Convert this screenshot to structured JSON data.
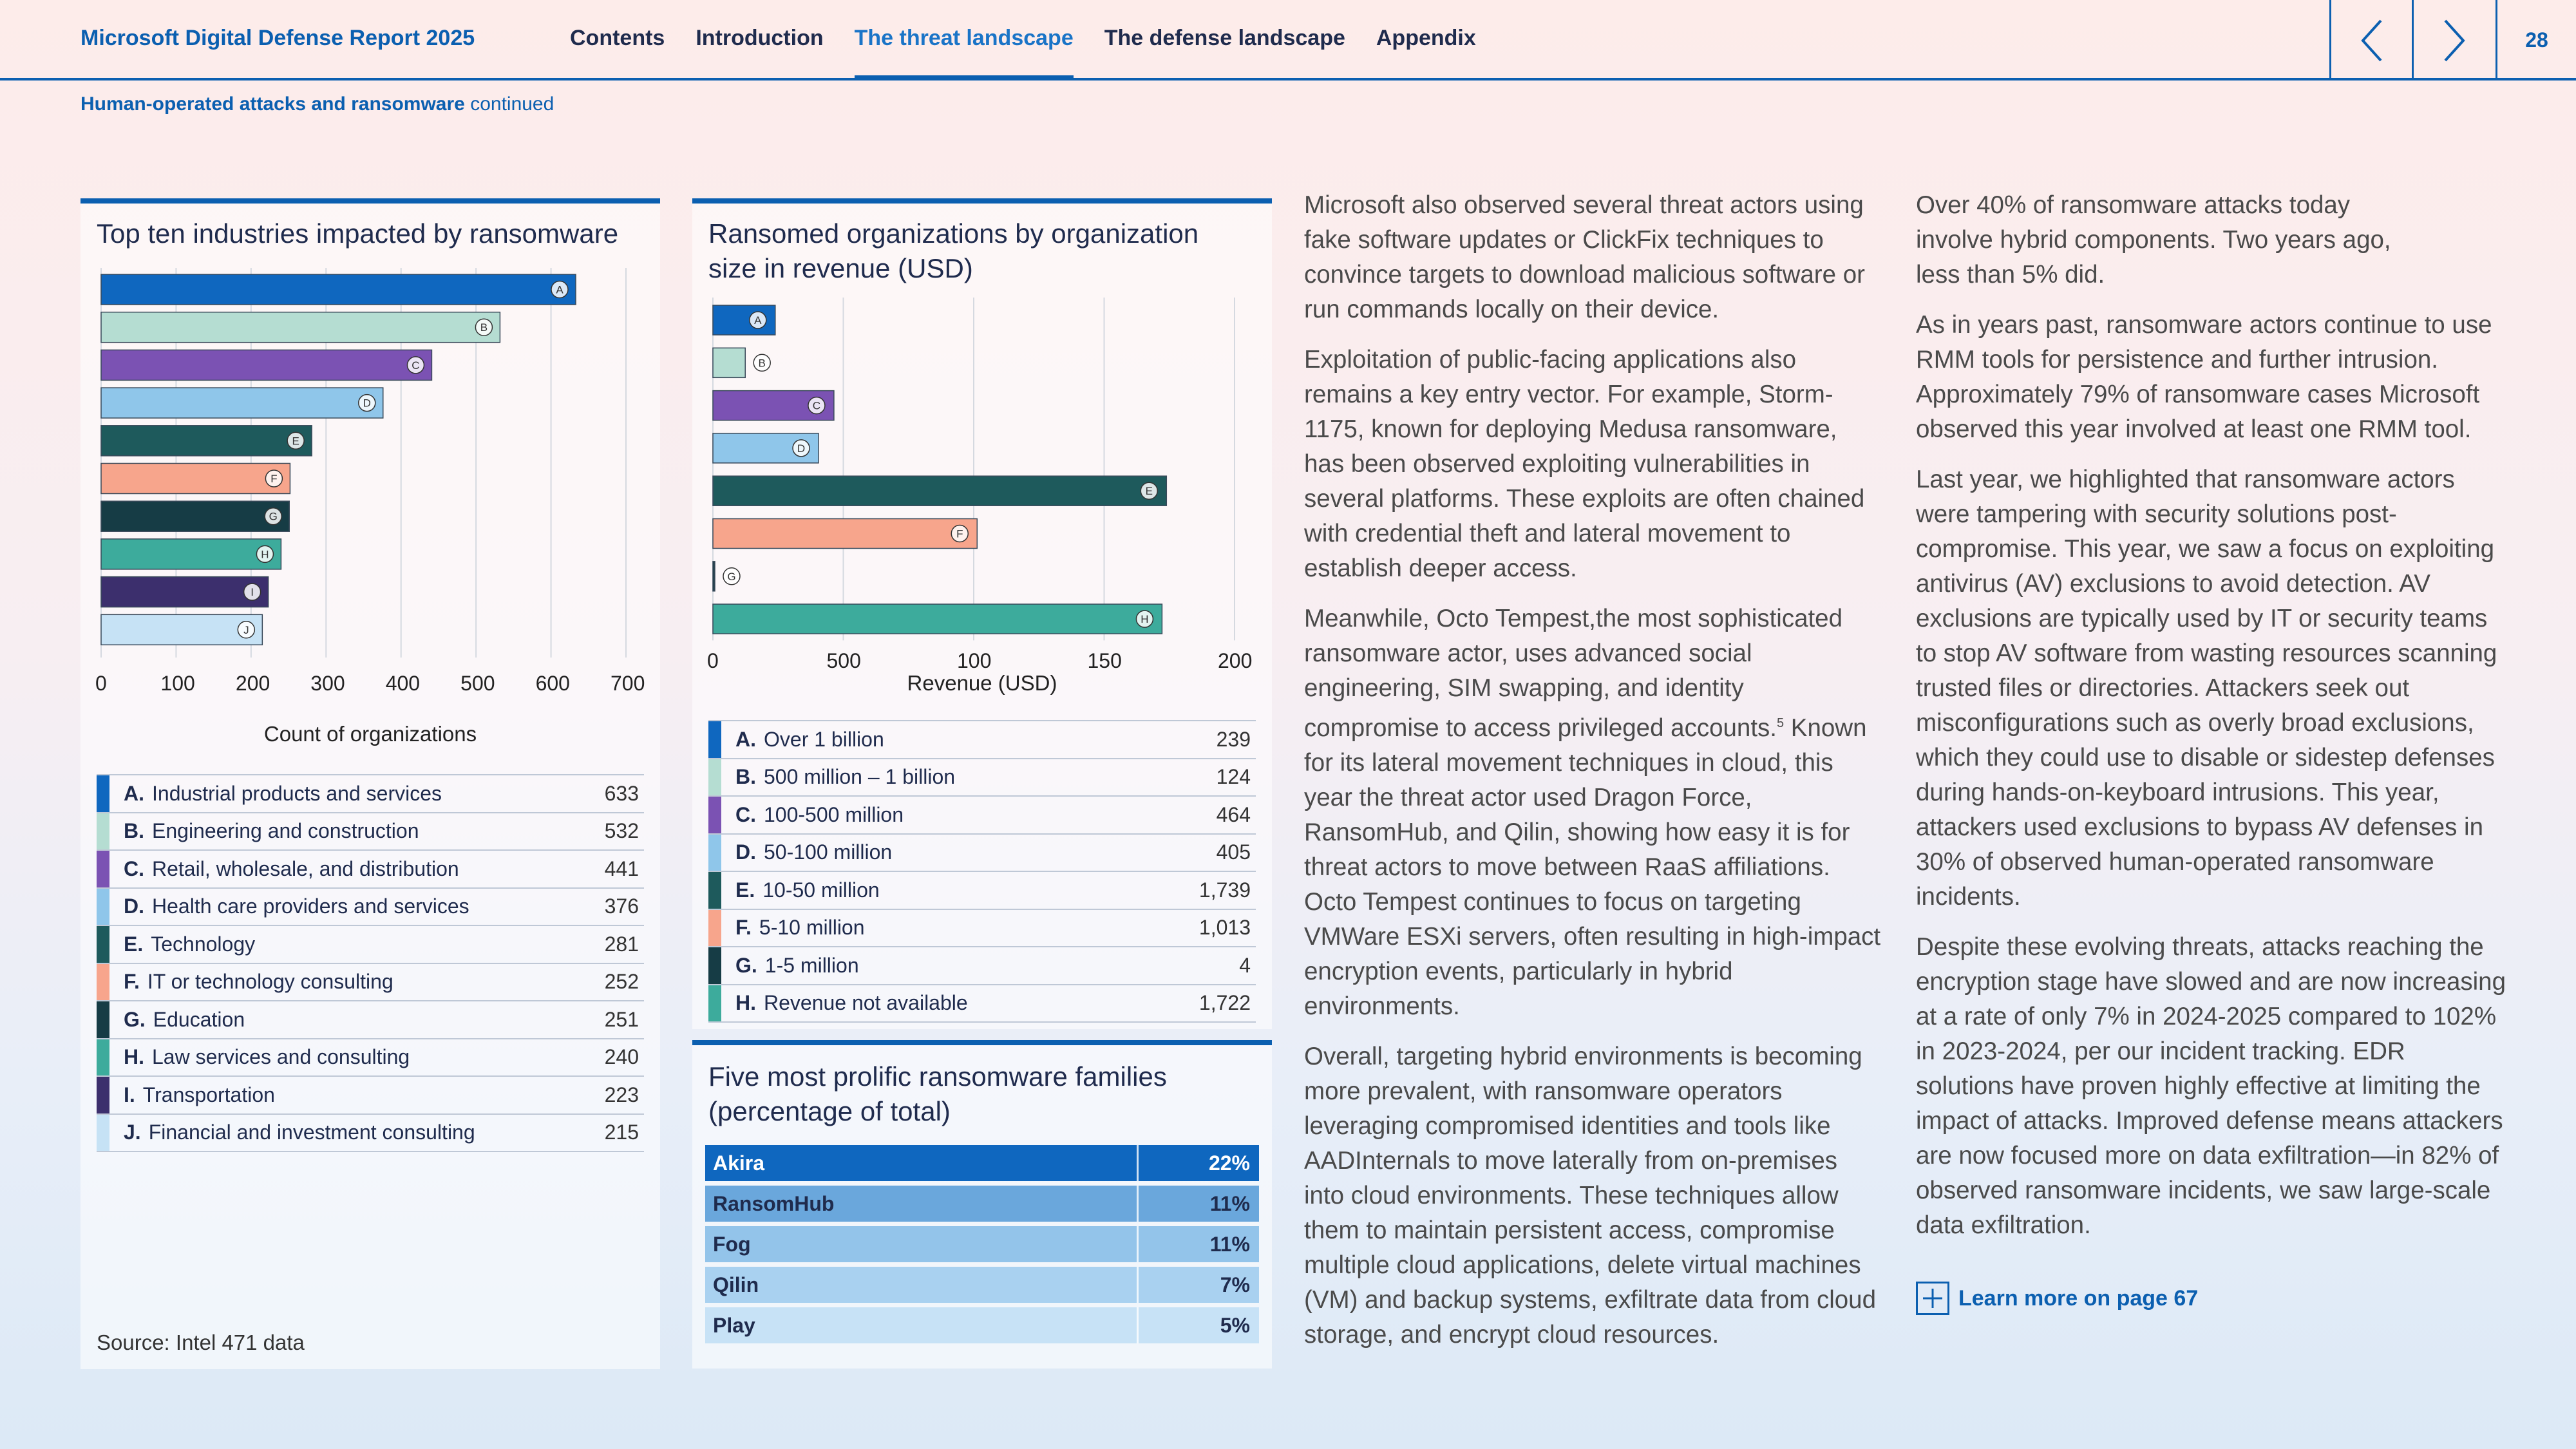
{
  "header": {
    "report_title": "Microsoft Digital Defense Report 2025",
    "nav": [
      "Contents",
      "Introduction",
      "The threat landscape",
      "The defense landscape",
      "Appendix"
    ],
    "page_number": "28"
  },
  "subtitle": {
    "section": "Human-operated attacks and ransomware",
    "suffix": " continued"
  },
  "industries_panel": {
    "title": "Top ten industries impacted by ransomware",
    "xlabel": "Count of organizations",
    "ticks": [
      "0",
      "100",
      "200",
      "300",
      "400",
      "500",
      "600",
      "700"
    ],
    "source": "Source: Intel 471 data"
  },
  "revenue_panel": {
    "title_line1": "Ransomed organizations by organization",
    "title_line2": "size in revenue (USD)",
    "xlabel": "Revenue (USD)",
    "ticks": [
      "0",
      "500",
      "100",
      "150",
      "200"
    ]
  },
  "families_panel": {
    "title_line1": "Five most prolific ransomware families",
    "title_line2": "(percentage of total)"
  },
  "chart_data": [
    {
      "type": "bar",
      "title": "Top ten industries impacted by ransomware",
      "xlabel": "Count of organizations",
      "xlim": [
        0,
        700
      ],
      "letters": [
        "A",
        "B",
        "C",
        "D",
        "E",
        "F",
        "G",
        "H",
        "I",
        "J"
      ],
      "categories": [
        "Industrial products and services",
        "Engineering and construction",
        "Retail, wholesale, and distribution",
        "Health care providers and services",
        "Technology",
        "IT or technology consulting",
        "Education",
        "Law services and consulting",
        "Transportation",
        "Financial and investment consulting"
      ],
      "values": [
        633,
        532,
        441,
        376,
        281,
        252,
        251,
        240,
        223,
        215
      ],
      "value_labels": [
        "633",
        "532",
        "441",
        "376",
        "281",
        "252",
        "251",
        "240",
        "223",
        "215"
      ],
      "colors": [
        "#0f67bf",
        "#b5ddd2",
        "#7b52b3",
        "#8fc6ea",
        "#1e5a5c",
        "#f7a58c",
        "#163c45",
        "#3dab9c",
        "#3c2f6d",
        "#c6e2f5"
      ]
    },
    {
      "type": "bar",
      "title": "Ransomed organizations by organization size in revenue (USD)",
      "xlabel": "Revenue (USD)",
      "xlim": [
        0,
        2000
      ],
      "letters": [
        "A",
        "B",
        "C",
        "D",
        "E",
        "F",
        "G",
        "H"
      ],
      "categories": [
        "Over 1 billion",
        "500 million – 1 billion",
        "100-500 million",
        "50-100 million",
        "10-50 million",
        "5-10 million",
        "1-5 million",
        "Revenue not available"
      ],
      "values": [
        239,
        124,
        464,
        405,
        1739,
        1013,
        4,
        1722
      ],
      "value_labels": [
        "239",
        "124",
        "464",
        "405",
        "1,739",
        "1,013",
        "4",
        "1,722"
      ],
      "colors": [
        "#0f67bf",
        "#b5ddd2",
        "#7b52b3",
        "#8fc6ea",
        "#1e5a5c",
        "#f7a58c",
        "#163c45",
        "#3dab9c"
      ]
    },
    {
      "type": "table",
      "title": "Five most prolific ransomware families (percentage of total)",
      "categories": [
        "Akira",
        "RansomHub",
        "Fog",
        "Qilin",
        "Play"
      ],
      "values": [
        22,
        11,
        11,
        7,
        5
      ],
      "value_labels": [
        "22%",
        "11%",
        "11%",
        "7%",
        "5%"
      ],
      "colors": [
        "#0f67bf",
        "#6aa7dc",
        "#93c4ea",
        "#a9d1f0",
        "#c7e2f6"
      ]
    }
  ],
  "column1": [
    "Microsoft also observed several threat actors using fake software updates or ClickFix techniques to convince targets to download malicious software or run commands locally on their device.",
    "Exploitation of public-facing applications also remains a key entry vector. For example, Storm-1175, known for deploying Medusa ransomware, has been observed exploiting vulnerabilities in several platforms. These exploits are often chained with credential theft and lateral movement to establish deeper access.",
    "Meanwhile, Octo Tempest,the most sophisticated ransomware actor, uses advanced social engineering, SIM swapping, and identity compromise to access privileged accounts.",
    " Known for its lateral movement techniques in cloud, this year the threat actor used Dragon Force, RansomHub, and Qilin, showing how easy it is for threat actors to move between RaaS affiliations. Octo Tempest continues to focus on targeting VMWare ESXi servers, often resulting in high-impact encryption events, particularly in hybrid environments.",
    "Overall, targeting hybrid environments is becoming more prevalent, with ransomware operators leveraging compromised identities and tools like AADInternals to move laterally from on-premises into cloud environments. These techniques allow them to maintain persistent access, compromise multiple cloud applications, delete virtual machines (VM) and backup systems, exfiltrate data from cloud storage, and encrypt cloud resources."
  ],
  "footnote_ref": "5",
  "column2": [
    "Over 40% of ransomware attacks today involve hybrid components. Two years ago, less than 5% did.",
    "As in years past, ransomware actors continue to use RMM tools for persistence and further intrusion. Approximately 79% of ransomware cases Microsoft observed this year involved at least one RMM tool.",
    "Last year, we highlighted that ransomware actors were tampering with security solutions post-compromise. This year, we saw a focus on exploiting antivirus (AV) exclusions to avoid detection. AV exclusions are typically used by IT or security teams to stop AV software from wasting resources scanning trusted files or directories. Attackers seek out misconfigurations such as overly broad exclusions, which they could use to disable or sidestep defenses during hands-on-keyboard intrusions. This year, attackers used exclusions to bypass AV defenses in 30% of observed human-operated ransomware incidents.",
    "Despite these evolving threats, attacks reaching the encryption stage have slowed and are now increasing at a rate of only 7% in 2024-2025 compared to 102% in 2023-2024, per our incident tracking. EDR solutions have proven highly effective at limiting the impact of attacks. Improved defense means attackers are now focused more on data exfiltration—in 82% of observed ransomware incidents, we saw large-scale data exfiltration."
  ],
  "learn_more": "Learn more on page 67"
}
